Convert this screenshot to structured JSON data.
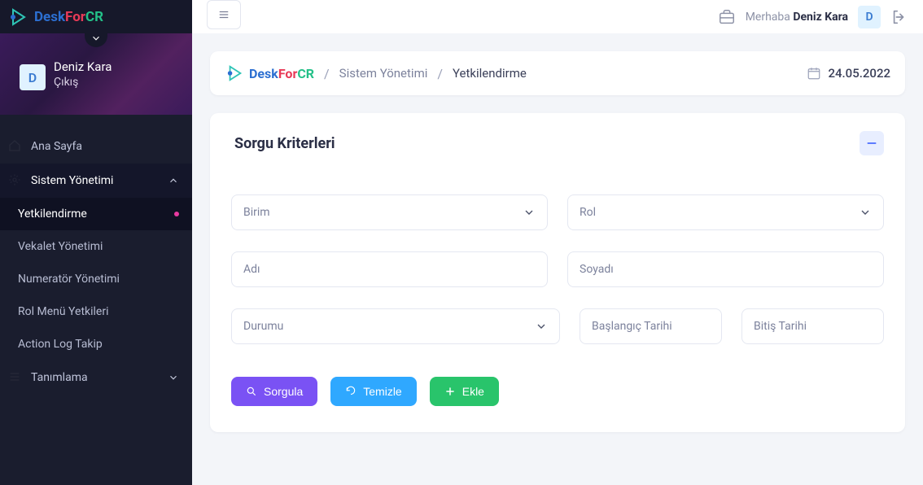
{
  "brand": {
    "name": "DeskForCR"
  },
  "header": {
    "greeting_prefix": "Merhaba",
    "user_name": "Deniz Kara",
    "avatar_letter": "D",
    "date": "24.05.2022"
  },
  "sidebar": {
    "avatar_letter": "D",
    "user_name": "Deniz Kara",
    "logout_label": "Çıkış",
    "items": [
      {
        "label": "Ana Sayfa",
        "expandable": false
      },
      {
        "label": "Sistem Yönetimi",
        "expandable": true,
        "expanded": true,
        "children": [
          {
            "label": "Yetkilendirme",
            "active": true
          },
          {
            "label": "Vekalet Yönetimi"
          },
          {
            "label": "Numeratör Yönetimi"
          },
          {
            "label": "Rol Menü Yetkileri"
          },
          {
            "label": "Action Log Takip"
          }
        ]
      },
      {
        "label": "Tanımlama",
        "expandable": true,
        "expanded": false
      }
    ]
  },
  "breadcrumb": {
    "items": [
      "Sistem Yönetimi",
      "Yetkilendirme"
    ]
  },
  "panel": {
    "title": "Sorgu Kriterleri",
    "fields": {
      "birim": "Birim",
      "rol": "Rol",
      "adi": "Adı",
      "soyadi": "Soyadı",
      "durumu": "Durumu",
      "baslangic": "Başlangıç Tarihi",
      "bitis": "Bitiş Tarihi"
    },
    "buttons": {
      "sorgula": "Sorgula",
      "temizle": "Temizle",
      "ekle": "Ekle"
    }
  }
}
